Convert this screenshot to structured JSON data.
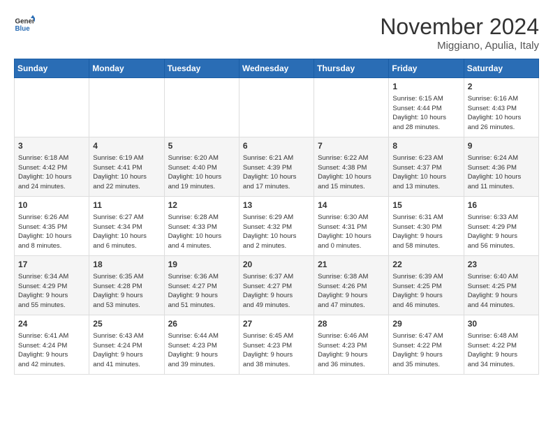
{
  "header": {
    "logo_line1": "General",
    "logo_line2": "Blue",
    "month": "November 2024",
    "location": "Miggiano, Apulia, Italy"
  },
  "weekdays": [
    "Sunday",
    "Monday",
    "Tuesday",
    "Wednesday",
    "Thursday",
    "Friday",
    "Saturday"
  ],
  "weeks": [
    [
      {
        "day": "",
        "info": ""
      },
      {
        "day": "",
        "info": ""
      },
      {
        "day": "",
        "info": ""
      },
      {
        "day": "",
        "info": ""
      },
      {
        "day": "",
        "info": ""
      },
      {
        "day": "1",
        "info": "Sunrise: 6:15 AM\nSunset: 4:44 PM\nDaylight: 10 hours\nand 28 minutes."
      },
      {
        "day": "2",
        "info": "Sunrise: 6:16 AM\nSunset: 4:43 PM\nDaylight: 10 hours\nand 26 minutes."
      }
    ],
    [
      {
        "day": "3",
        "info": "Sunrise: 6:18 AM\nSunset: 4:42 PM\nDaylight: 10 hours\nand 24 minutes."
      },
      {
        "day": "4",
        "info": "Sunrise: 6:19 AM\nSunset: 4:41 PM\nDaylight: 10 hours\nand 22 minutes."
      },
      {
        "day": "5",
        "info": "Sunrise: 6:20 AM\nSunset: 4:40 PM\nDaylight: 10 hours\nand 19 minutes."
      },
      {
        "day": "6",
        "info": "Sunrise: 6:21 AM\nSunset: 4:39 PM\nDaylight: 10 hours\nand 17 minutes."
      },
      {
        "day": "7",
        "info": "Sunrise: 6:22 AM\nSunset: 4:38 PM\nDaylight: 10 hours\nand 15 minutes."
      },
      {
        "day": "8",
        "info": "Sunrise: 6:23 AM\nSunset: 4:37 PM\nDaylight: 10 hours\nand 13 minutes."
      },
      {
        "day": "9",
        "info": "Sunrise: 6:24 AM\nSunset: 4:36 PM\nDaylight: 10 hours\nand 11 minutes."
      }
    ],
    [
      {
        "day": "10",
        "info": "Sunrise: 6:26 AM\nSunset: 4:35 PM\nDaylight: 10 hours\nand 8 minutes."
      },
      {
        "day": "11",
        "info": "Sunrise: 6:27 AM\nSunset: 4:34 PM\nDaylight: 10 hours\nand 6 minutes."
      },
      {
        "day": "12",
        "info": "Sunrise: 6:28 AM\nSunset: 4:33 PM\nDaylight: 10 hours\nand 4 minutes."
      },
      {
        "day": "13",
        "info": "Sunrise: 6:29 AM\nSunset: 4:32 PM\nDaylight: 10 hours\nand 2 minutes."
      },
      {
        "day": "14",
        "info": "Sunrise: 6:30 AM\nSunset: 4:31 PM\nDaylight: 10 hours\nand 0 minutes."
      },
      {
        "day": "15",
        "info": "Sunrise: 6:31 AM\nSunset: 4:30 PM\nDaylight: 9 hours\nand 58 minutes."
      },
      {
        "day": "16",
        "info": "Sunrise: 6:33 AM\nSunset: 4:29 PM\nDaylight: 9 hours\nand 56 minutes."
      }
    ],
    [
      {
        "day": "17",
        "info": "Sunrise: 6:34 AM\nSunset: 4:29 PM\nDaylight: 9 hours\nand 55 minutes."
      },
      {
        "day": "18",
        "info": "Sunrise: 6:35 AM\nSunset: 4:28 PM\nDaylight: 9 hours\nand 53 minutes."
      },
      {
        "day": "19",
        "info": "Sunrise: 6:36 AM\nSunset: 4:27 PM\nDaylight: 9 hours\nand 51 minutes."
      },
      {
        "day": "20",
        "info": "Sunrise: 6:37 AM\nSunset: 4:27 PM\nDaylight: 9 hours\nand 49 minutes."
      },
      {
        "day": "21",
        "info": "Sunrise: 6:38 AM\nSunset: 4:26 PM\nDaylight: 9 hours\nand 47 minutes."
      },
      {
        "day": "22",
        "info": "Sunrise: 6:39 AM\nSunset: 4:25 PM\nDaylight: 9 hours\nand 46 minutes."
      },
      {
        "day": "23",
        "info": "Sunrise: 6:40 AM\nSunset: 4:25 PM\nDaylight: 9 hours\nand 44 minutes."
      }
    ],
    [
      {
        "day": "24",
        "info": "Sunrise: 6:41 AM\nSunset: 4:24 PM\nDaylight: 9 hours\nand 42 minutes."
      },
      {
        "day": "25",
        "info": "Sunrise: 6:43 AM\nSunset: 4:24 PM\nDaylight: 9 hours\nand 41 minutes."
      },
      {
        "day": "26",
        "info": "Sunrise: 6:44 AM\nSunset: 4:23 PM\nDaylight: 9 hours\nand 39 minutes."
      },
      {
        "day": "27",
        "info": "Sunrise: 6:45 AM\nSunset: 4:23 PM\nDaylight: 9 hours\nand 38 minutes."
      },
      {
        "day": "28",
        "info": "Sunrise: 6:46 AM\nSunset: 4:23 PM\nDaylight: 9 hours\nand 36 minutes."
      },
      {
        "day": "29",
        "info": "Sunrise: 6:47 AM\nSunset: 4:22 PM\nDaylight: 9 hours\nand 35 minutes."
      },
      {
        "day": "30",
        "info": "Sunrise: 6:48 AM\nSunset: 4:22 PM\nDaylight: 9 hours\nand 34 minutes."
      }
    ]
  ]
}
